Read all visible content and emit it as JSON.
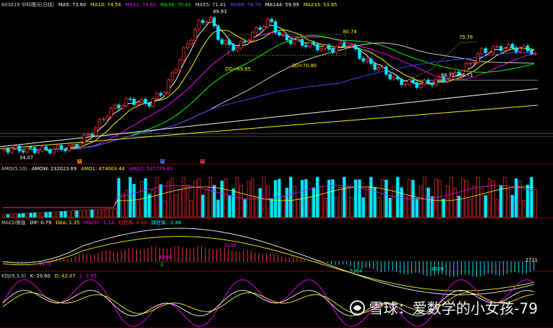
{
  "main_legend": {
    "code": "603019 中科曙光(日线)",
    "items": [
      {
        "text": "MA5: 73.60",
        "color": "#ffffff"
      },
      {
        "text": "MA10: 74.54",
        "color": "#ffff00"
      },
      {
        "text": "MA21: 74.62",
        "color": "#ff00ff"
      },
      {
        "text": "MA34: 70.41",
        "color": "#00ff00"
      },
      {
        "text": "MA55: 71.41",
        "color": "#d0d0d0"
      },
      {
        "text": "MA89: 76.70",
        "color": "#4040ff"
      },
      {
        "text": "MA144: 59.99",
        "color": "#ffffff"
      },
      {
        "text": "MA233: 53.85",
        "color": "#ffff00"
      }
    ]
  },
  "amo_legend": {
    "items": [
      {
        "text": "AMO(5,10)",
        "color": "#cccccc"
      },
      {
        "text": "AMOW: 232023.69",
        "color": "#ffffff"
      },
      {
        "text": "AMO1: 474003.44",
        "color": "#ffff00"
      },
      {
        "text": "AMO2: 525729.81",
        "color": "#ff00ff"
      }
    ]
  },
  "macd_legend": {
    "items": [
      {
        "text": "MACD做值",
        "color": "#cccccc"
      },
      {
        "text": "DIF: 0.79",
        "color": "#ffffff"
      },
      {
        "text": "DEA: 1.35",
        "color": "#ffff00"
      },
      {
        "text": "MACD: -1.14",
        "color": "#ff00ff"
      },
      {
        "text": "红柱体: 0.00",
        "color": "#ff3333"
      },
      {
        "text": "绿柱体: -2.86",
        "color": "#00ffff"
      }
    ]
  },
  "kdj_legend": {
    "items": [
      {
        "text": "KDJ(9,3,3)",
        "color": "#cccccc"
      },
      {
        "text": "K: 20.60",
        "color": "#ffffff"
      },
      {
        "text": "D: 42.07",
        "color": "#ffff00"
      },
      {
        "text": "J: -1.65",
        "color": "#ff00ff"
      }
    ]
  },
  "annotations": {
    "high": "89.93",
    "low_left": "34.07",
    "dd": "DD=69.85",
    "zd": "ZD=70.80",
    "p80": "80.74",
    "p79": "79.78",
    "zone": "66.71~66.73",
    "macd_3109": "3109",
    "macd_4288": "4288",
    "macd_2": "2",
    "macd_1473": "1473",
    "macd_5364": "5364",
    "macd_4509": "4509",
    "macd_2721": "2721"
  },
  "markers": [
    "金",
    "财",
    "券"
  ],
  "watermark": "雪球：爱数学的小女孩-79"
}
